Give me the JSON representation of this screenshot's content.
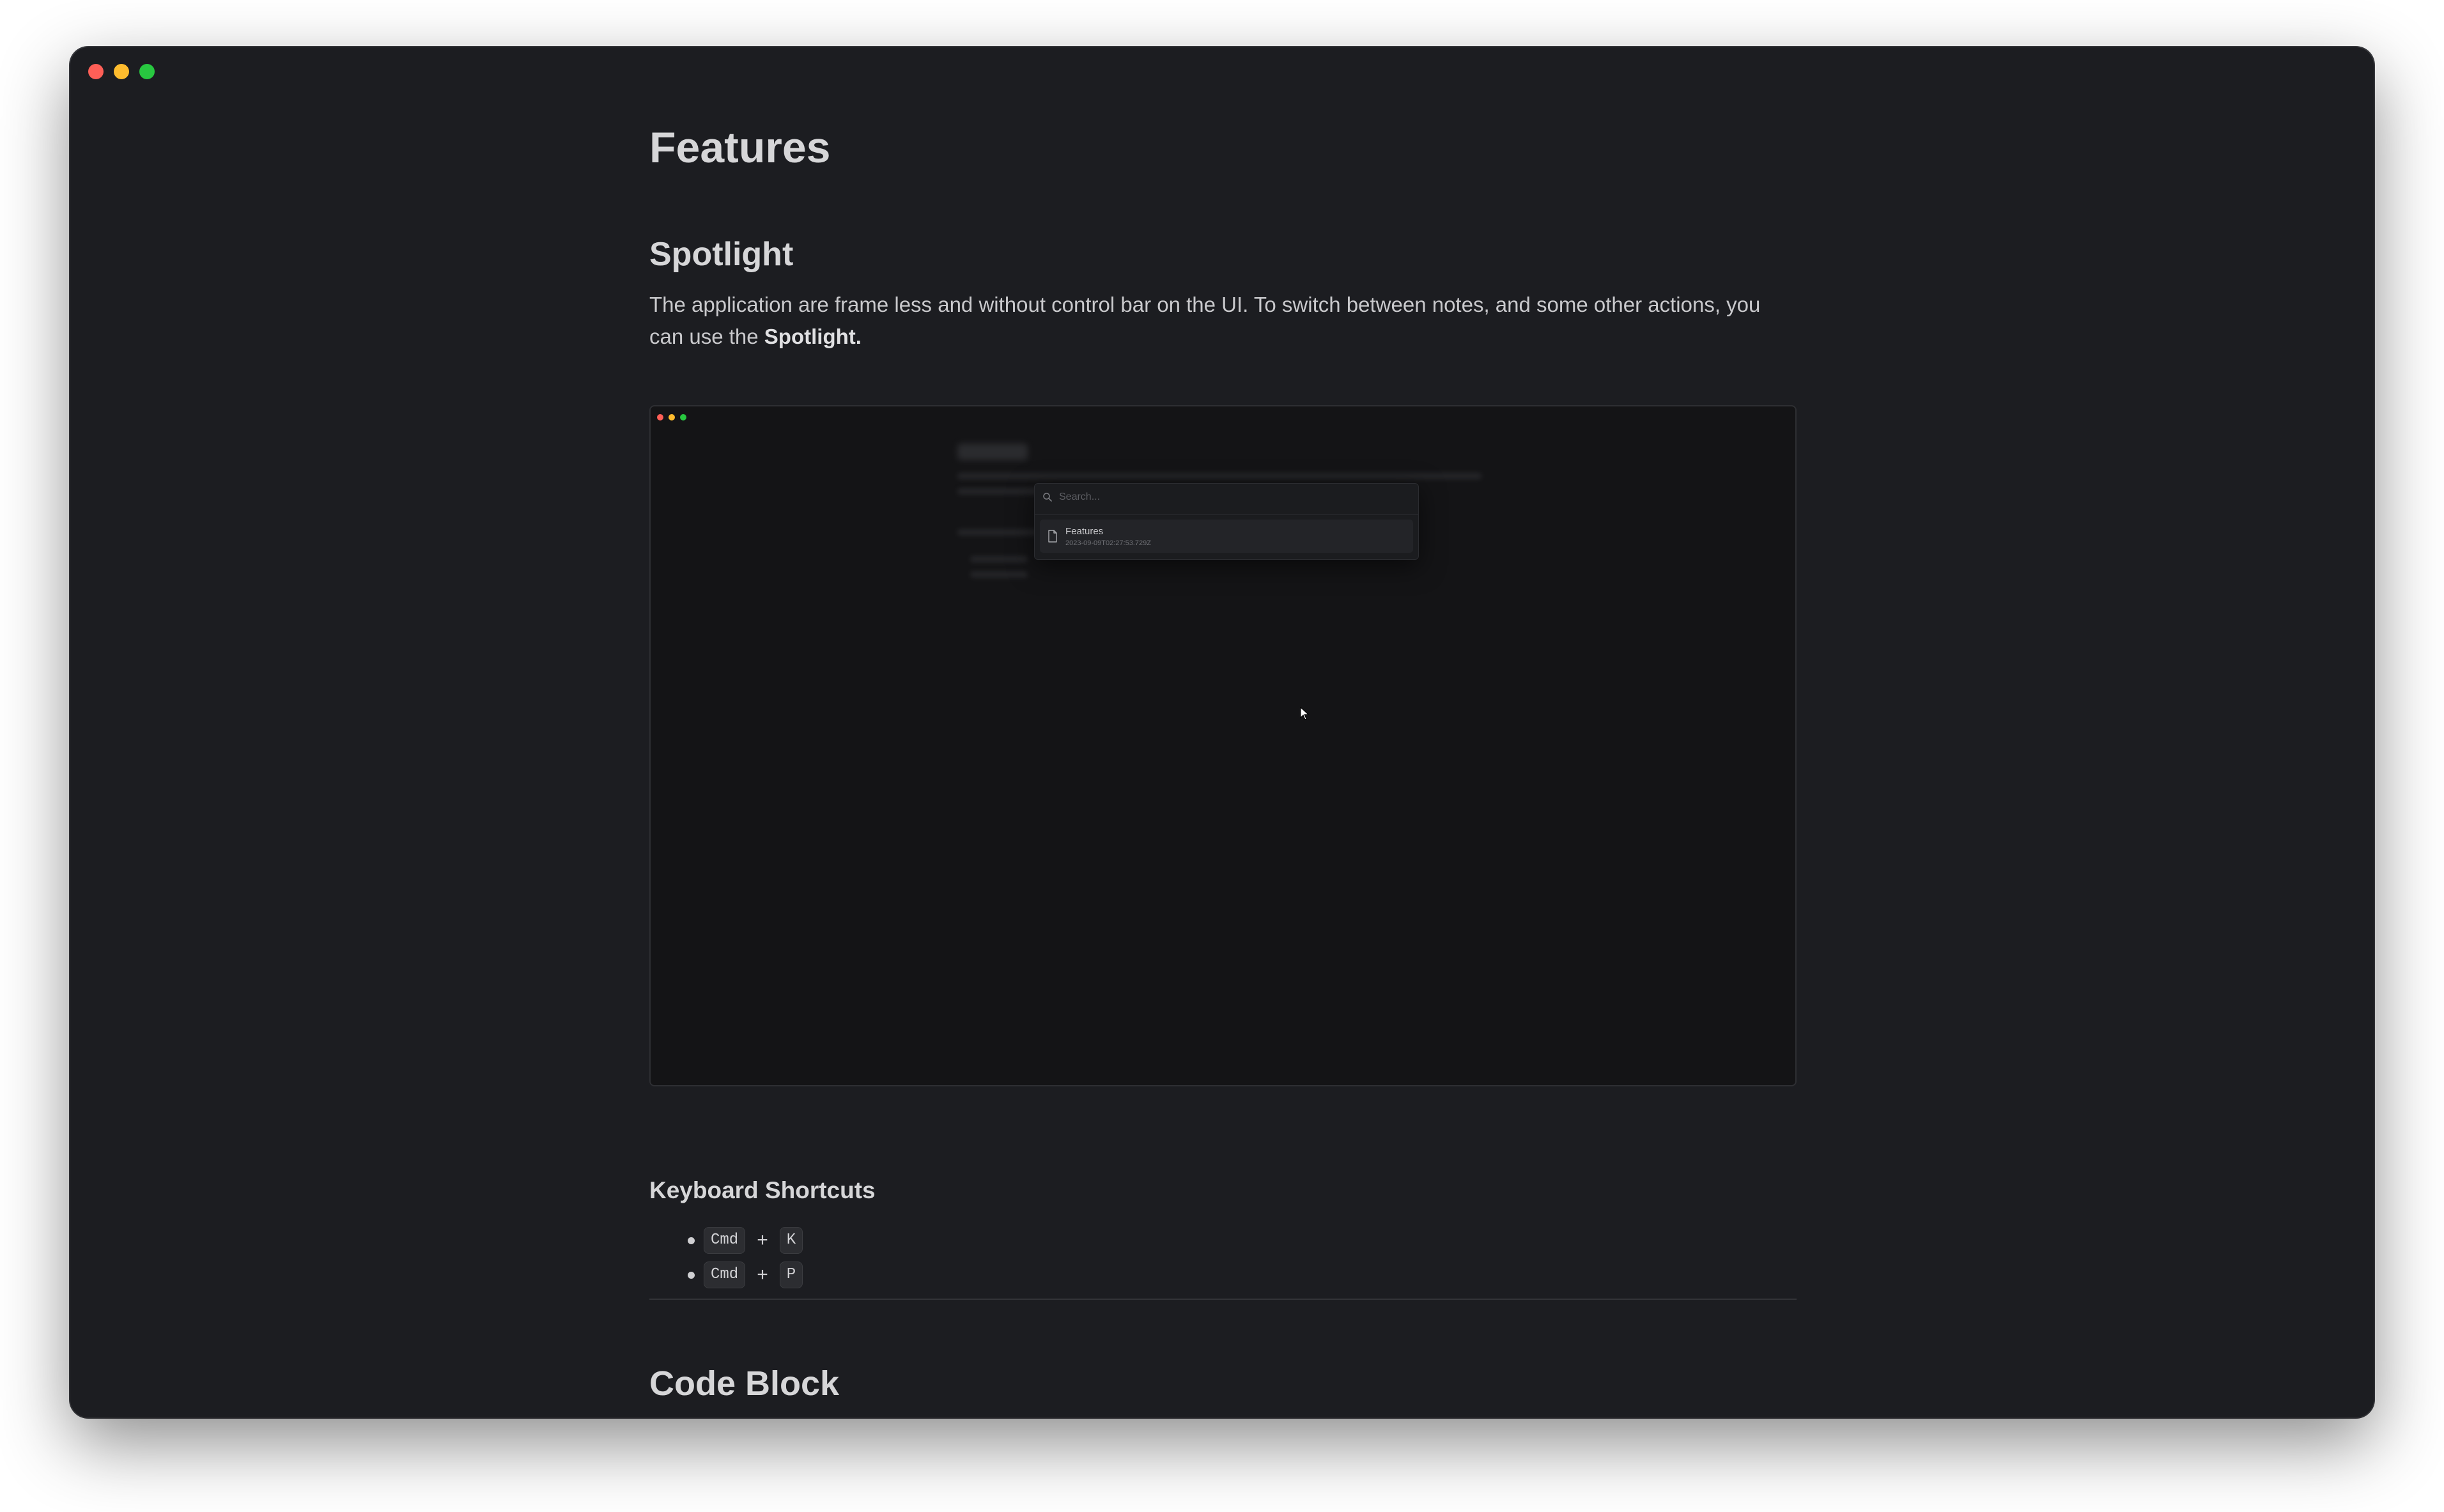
{
  "page": {
    "title": "Features",
    "section_heading": "Spotlight",
    "paragraph_text": "The application are frame less and without control bar on the UI. To switch between notes, and some other actions, you can use the ",
    "paragraph_bold": "Spotlight.",
    "subsection_heading": "Keyboard Shortcuts",
    "shortcuts": [
      {
        "modifier": "Cmd",
        "plus": "+",
        "key": "K"
      },
      {
        "modifier": "Cmd",
        "plus": "+",
        "key": "P"
      }
    ],
    "next_section_heading": "Code Block"
  },
  "screenshot": {
    "search_placeholder": "Search...",
    "result_title": "Features",
    "result_date": "2023-09-09T02:27:53.729Z"
  },
  "colors": {
    "window_bg": "#1c1d21",
    "close": "#fe5f57",
    "minimize": "#febc2e",
    "maximize": "#28c840"
  }
}
